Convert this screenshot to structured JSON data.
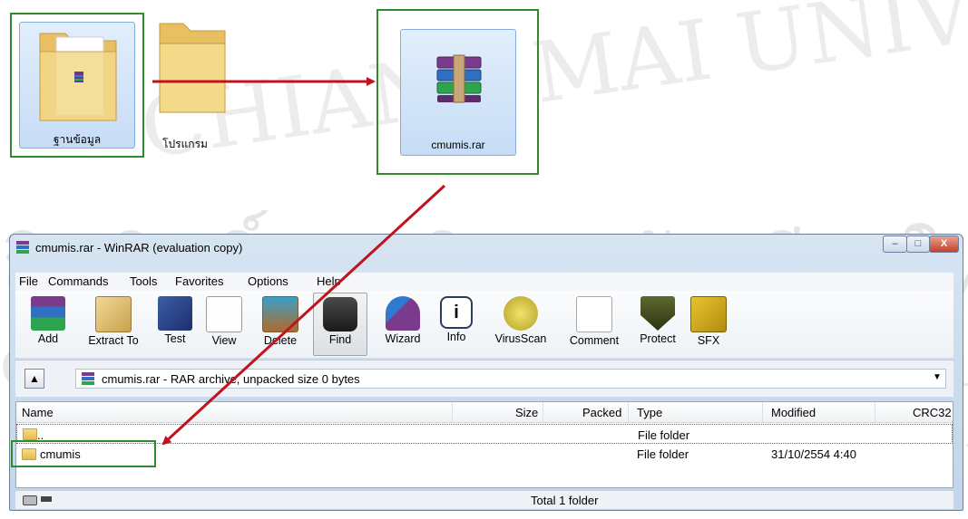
{
  "desktop": {
    "icons": [
      {
        "label": "ฐานข้อมูล"
      },
      {
        "label": "โปรแกรม"
      },
      {
        "label": "cmumis.rar"
      }
    ]
  },
  "window": {
    "title": "cmumis.rar - WinRAR (evaluation copy)",
    "controls": {
      "minimize": "–",
      "maximize": "□",
      "close": "X"
    },
    "menu": [
      "File",
      "Commands",
      "Tools",
      "Favorites",
      "Options",
      "Help"
    ],
    "toolbar": [
      {
        "label": "Add",
        "icon": "add-archive-icon"
      },
      {
        "label": "Extract To",
        "icon": "extract-icon"
      },
      {
        "label": "Test",
        "icon": "test-icon"
      },
      {
        "label": "View",
        "icon": "view-icon"
      },
      {
        "label": "Delete",
        "icon": "delete-icon"
      },
      {
        "label": "Find",
        "icon": "find-icon"
      },
      {
        "label": "Wizard",
        "icon": "wizard-icon"
      },
      {
        "label": "Info",
        "icon": "info-icon"
      },
      {
        "label": "VirusScan",
        "icon": "virusscan-icon"
      },
      {
        "label": "Comment",
        "icon": "comment-icon"
      },
      {
        "label": "Protect",
        "icon": "protect-icon"
      },
      {
        "label": "SFX",
        "icon": "sfx-icon"
      }
    ],
    "path": "cmumis.rar - RAR archive, unpacked size 0 bytes",
    "columns": {
      "name": "Name",
      "size": "Size",
      "packed": "Packed",
      "type": "Type",
      "modified": "Modified",
      "crc": "CRC32"
    },
    "rows": [
      {
        "name": "..",
        "size": "",
        "packed": "",
        "type": "File folder",
        "modified": "",
        "crc": ""
      },
      {
        "name": "cmumis",
        "size": "",
        "packed": "",
        "type": "File folder",
        "modified": "31/10/2554 4:40",
        "crc": ""
      }
    ],
    "status": "Total 1 folder"
  },
  "watermark": {
    "thai": "ลิขสิทธิ์มหาวิทยาลัยเชียงใหม่",
    "copyright": "Copyright by Chiang Mai University",
    "rights": "A l l   r i g h t s   r e s e r v e d",
    "arc": "CHIANG MAI UNIVERSITY"
  },
  "colors": {
    "highlight_border": "#2e8b2e",
    "arrow": "#c0141c"
  }
}
